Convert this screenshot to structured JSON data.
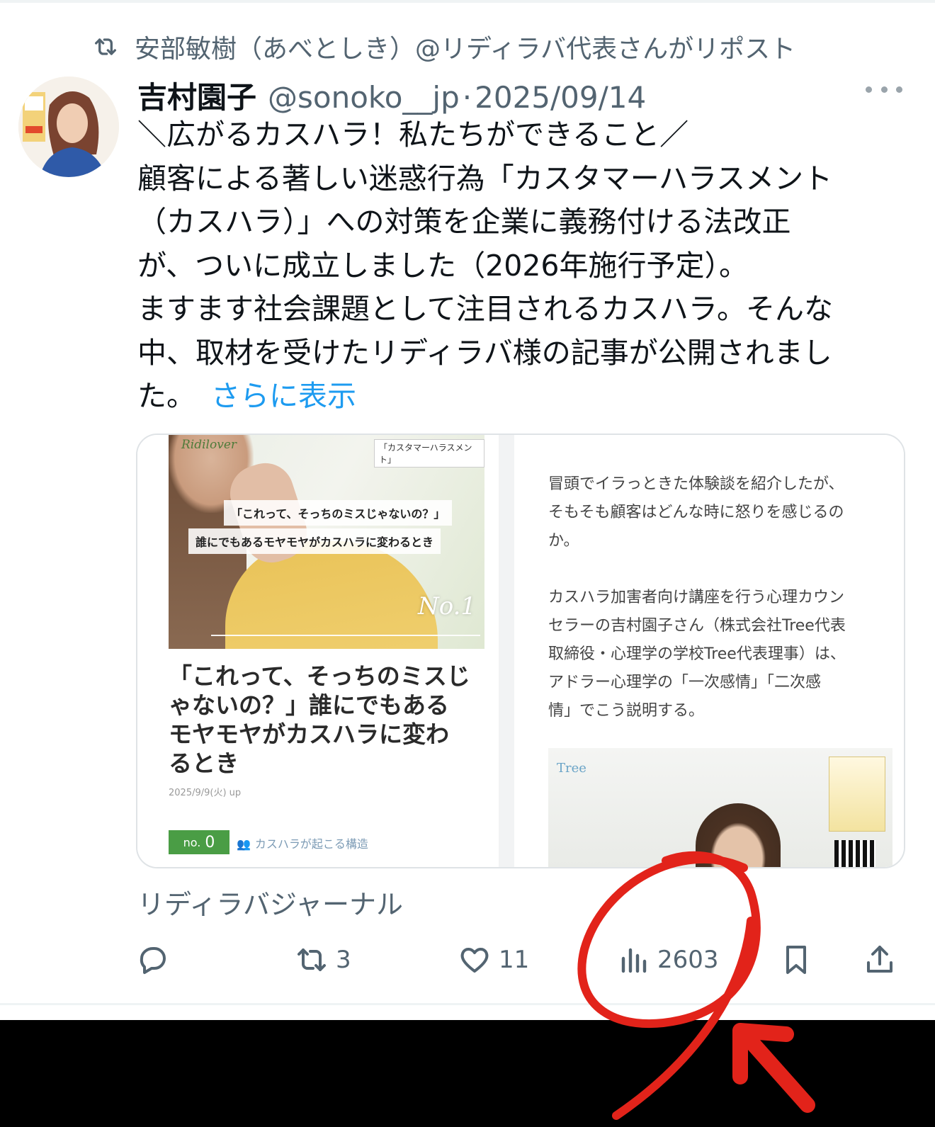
{
  "repost": {
    "text": "安部敏樹（あべとしき）@リディラバ代表さんがリポスト",
    "icon": "repost-icon"
  },
  "tweet": {
    "display_name": "吉村園子",
    "handle": "@sonoko__jp",
    "separator": "·",
    "date": "2025/09/14",
    "lines": [
      "＼広がるカスハラ！私たちができること／",
      "顧客による著しい迷惑行為「カスタマーハラスメント",
      "（カスハラ）」への対策を企業に義務付ける法改正",
      "が、ついに成立しました（2026年施行予定）。",
      "ますます社会課題として注目されるカスハラ。そんな",
      "中、取材を受けたリディラバ様の記事が公開されまし",
      "た。"
    ],
    "show_more": "さらに表示"
  },
  "card": {
    "hero": {
      "logo": "Ridilover",
      "tag": "「カスタマーハラスメント」",
      "caption1": "「これって、そっちのミスじゃないの？」",
      "caption2": "誰にでもあるモヤモヤがカスハラに変わるとき",
      "no": "No.1"
    },
    "title_lines": [
      "「これって、そっちのミスじ",
      "ゃないの？」誰にでもある",
      "モヤモヤがカスハラに変わ",
      "るとき"
    ],
    "date": "2025/9/9(火) up",
    "badge_prefix": "no.",
    "badge_number": "0",
    "category": "カスハラが起こる構造",
    "right_para1": [
      "冒頭でイラっときた体験談を紹介したが、",
      "そもそも顧客はどんな時に怒りを感じるの",
      "か。"
    ],
    "right_para2": [
      "カスハラ加害者向け講座を行う心理カウン",
      "セラーの吉村園子さん（株式会社Tree代表",
      "取締役・心理学の学校Tree代表理事）は、",
      "アドラー心理学の「一次感情」「二次感",
      "情」でこう説明する。"
    ],
    "photo_logo": "Tree"
  },
  "source": "リディラバジャーナル",
  "actions": {
    "reply": {
      "icon": "reply-icon",
      "count": ""
    },
    "repost": {
      "icon": "repost-icon",
      "count": "3"
    },
    "like": {
      "icon": "heart-icon",
      "count": "11"
    },
    "views": {
      "icon": "views-icon",
      "count": "2603"
    },
    "bookmark": {
      "icon": "bookmark-icon"
    },
    "share": {
      "icon": "share-icon"
    }
  },
  "colors": {
    "text": "#0f1419",
    "secondary": "#536471",
    "link": "#1d9bf0",
    "annotation": "#e2231a"
  }
}
